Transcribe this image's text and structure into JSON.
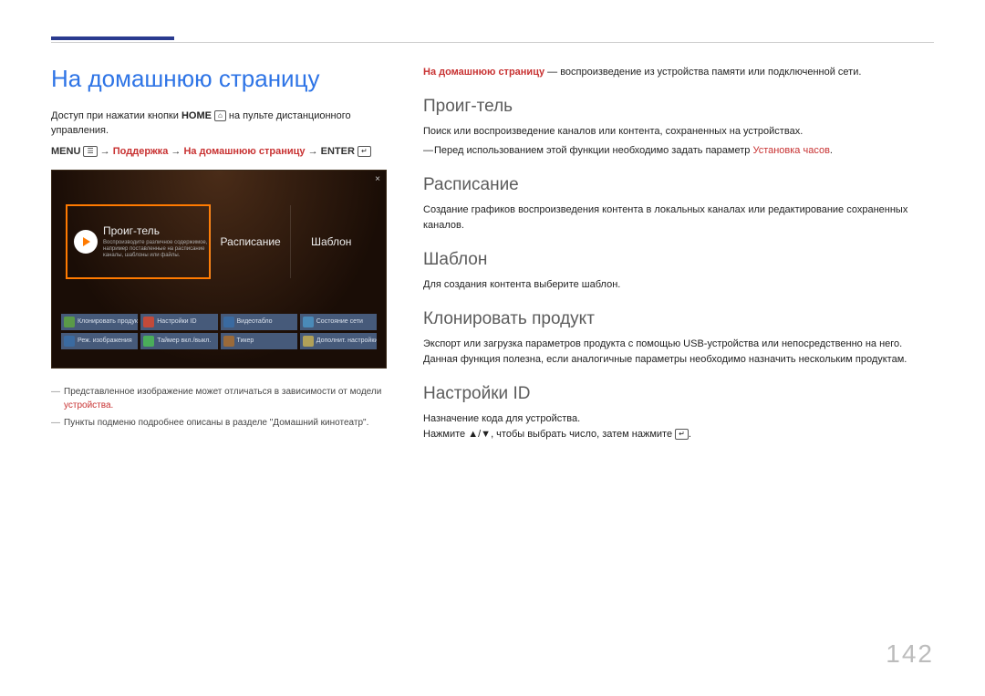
{
  "page_number": "142",
  "left": {
    "title": "На домашнюю страницу",
    "access_prefix": "Доступ при нажатии кнопки ",
    "access_bold": "HOME",
    "access_icon_glyph": "⌂",
    "access_suffix": " на пульте дистанционного управления.",
    "path_menu": "MENU",
    "path_menu_icon": "☰",
    "path_arrow": " → ",
    "path_support": "Поддержка",
    "path_home": "На домашнюю страницу",
    "path_enter": "ENTER",
    "path_enter_icon": "↵",
    "note1_prefix": "Представленное изображение может отличаться в зависимости от модели ",
    "note1_red": "устройства.",
    "note2": "Пункты подменю подробнее описаны в разделе \"Домашний кинотеатр\"."
  },
  "screenshot": {
    "close_glyph": "×",
    "tile1": "Проиг-тель",
    "tile1_sub": "Воспроизводите различное содержимое, например поставленные на расписание каналы, шаблоны или файлы.",
    "tile2": "Расписание",
    "tile3": "Шаблон",
    "grid": [
      {
        "label": "Клонировать продукт",
        "color": "#5a9a48"
      },
      {
        "label": "Настройки ID",
        "color": "#c24a3a"
      },
      {
        "label": "Видеотабло",
        "color": "#3a6aa0"
      },
      {
        "label": "Состояние сети",
        "color": "#4a8ab8"
      },
      {
        "label": "Реж. изображения",
        "color": "#3a6aa0"
      },
      {
        "label": "Таймер вкл./выкл.",
        "color": "#4aad5a"
      },
      {
        "label": "Тикер",
        "color": "#9a6a3a"
      },
      {
        "label": "Дополнит. настройки",
        "color": "#b0a058"
      }
    ]
  },
  "right": {
    "intro_bold": "На домашнюю страницу",
    "intro_rest": " — воспроизведение из устройства памяти или подключенной сети.",
    "sections": {
      "player": {
        "title": "Проиг-тель",
        "body": "Поиск или воспроизведение каналов или контента, сохраненных на устройствах.",
        "dash_prefix": "Перед использованием этой функции необходимо задать параметр ",
        "dash_red": "Установка часов",
        "dash_suffix": "."
      },
      "schedule": {
        "title": "Расписание",
        "body": "Создание графиков воспроизведения контента в локальных каналах или редактирование сохраненных каналов."
      },
      "template": {
        "title": "Шаблон",
        "body": "Для создания контента выберите шаблон."
      },
      "clone": {
        "title": "Клонировать продукт",
        "body": "Экспорт или загрузка параметров продукта с помощью USB-устройства или непосредственно на него. Данная функция полезна, если аналогичные параметры необходимо назначить нескольким продуктам."
      },
      "idset": {
        "title": "Настройки ID",
        "body1": "Назначение кода для устройства.",
        "body2_prefix": "Нажмите ",
        "body2_arrows": "▲/▼",
        "body2_mid": ", чтобы выбрать число, затем нажмите ",
        "body2_icon": "↵",
        "body2_suffix": "."
      }
    }
  }
}
